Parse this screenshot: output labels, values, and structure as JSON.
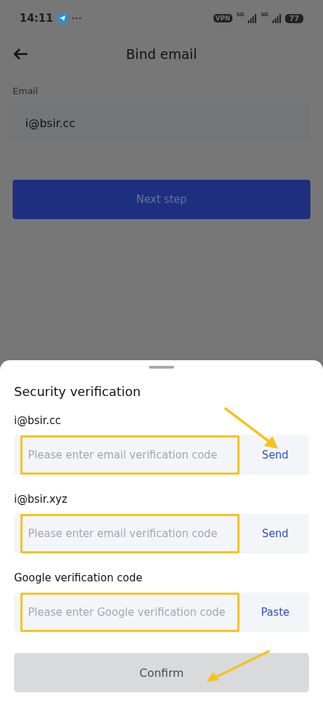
{
  "status_bar": {
    "time": "14:11",
    "vpn": "VPN",
    "networks": [
      "5G",
      "5G"
    ],
    "battery": "77"
  },
  "header": {
    "title": "Bind email"
  },
  "form": {
    "label": "Email",
    "value": "i@bsir.cc",
    "button": "Next step"
  },
  "sheet": {
    "title": "Security verification",
    "fields": [
      {
        "label": "i@bsir.cc",
        "placeholder": "Please enter email verification code",
        "action": "Send",
        "highlighted": true
      },
      {
        "label": "i@bsir.xyz",
        "placeholder": "Please enter email verification code",
        "action": "Send",
        "highlighted": true
      },
      {
        "label": "Google verification code",
        "placeholder": "Please enter Google verification code",
        "action": "Paste",
        "highlighted": true
      }
    ],
    "confirm": {
      "label": "Confirm",
      "disabled": true
    }
  }
}
